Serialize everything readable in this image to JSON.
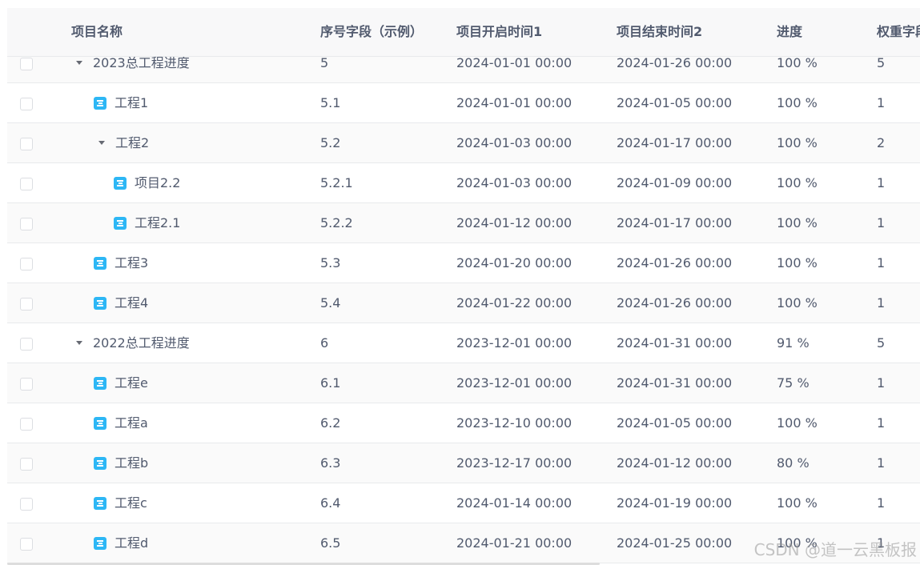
{
  "headers": {
    "name": "项目名称",
    "seq": "序号字段（示例）",
    "start": "项目开启时间1",
    "end": "项目结束时间2",
    "progress": "进度",
    "weight": "权重字段"
  },
  "rows": [
    {
      "name": "2023总工程进度",
      "level": 0,
      "type": "group",
      "seq": "5",
      "start": "2024-01-01 00:00",
      "end": "2024-01-26 00:00",
      "progress": "100 %",
      "weight": "5"
    },
    {
      "name": "工程1",
      "level": 1,
      "type": "leaf",
      "seq": "5.1",
      "start": "2024-01-01 00:00",
      "end": "2024-01-05 00:00",
      "progress": "100 %",
      "weight": "1"
    },
    {
      "name": "工程2",
      "level": 1,
      "type": "group",
      "seq": "5.2",
      "start": "2024-01-03 00:00",
      "end": "2024-01-17 00:00",
      "progress": "100 %",
      "weight": "2"
    },
    {
      "name": "项目2.2",
      "level": 2,
      "type": "leaf",
      "seq": "5.2.1",
      "start": "2024-01-03 00:00",
      "end": "2024-01-09 00:00",
      "progress": "100 %",
      "weight": "1"
    },
    {
      "name": "工程2.1",
      "level": 2,
      "type": "leaf",
      "seq": "5.2.2",
      "start": "2024-01-12 00:00",
      "end": "2024-01-17 00:00",
      "progress": "100 %",
      "weight": "1"
    },
    {
      "name": "工程3",
      "level": 1,
      "type": "leaf",
      "seq": "5.3",
      "start": "2024-01-20 00:00",
      "end": "2024-01-26 00:00",
      "progress": "100 %",
      "weight": "1"
    },
    {
      "name": "工程4",
      "level": 1,
      "type": "leaf",
      "seq": "5.4",
      "start": "2024-01-22 00:00",
      "end": "2024-01-26 00:00",
      "progress": "100 %",
      "weight": "1"
    },
    {
      "name": "2022总工程进度",
      "level": 0,
      "type": "group",
      "seq": "6",
      "start": "2023-12-01 00:00",
      "end": "2024-01-31 00:00",
      "progress": "91 %",
      "weight": "5"
    },
    {
      "name": "工程e",
      "level": 1,
      "type": "leaf",
      "seq": "6.1",
      "start": "2023-12-01 00:00",
      "end": "2024-01-31 00:00",
      "progress": "75 %",
      "weight": "1"
    },
    {
      "name": "工程a",
      "level": 1,
      "type": "leaf",
      "seq": "6.2",
      "start": "2023-12-10 00:00",
      "end": "2024-01-05 00:00",
      "progress": "100 %",
      "weight": "1"
    },
    {
      "name": "工程b",
      "level": 1,
      "type": "leaf",
      "seq": "6.3",
      "start": "2023-12-17 00:00",
      "end": "2024-01-12 00:00",
      "progress": "80 %",
      "weight": "1"
    },
    {
      "name": "工程c",
      "level": 1,
      "type": "leaf",
      "seq": "6.4",
      "start": "2024-01-14 00:00",
      "end": "2024-01-19 00:00",
      "progress": "100 %",
      "weight": "1"
    },
    {
      "name": "工程d",
      "level": 1,
      "type": "leaf",
      "seq": "6.5",
      "start": "2024-01-21 00:00",
      "end": "2024-01-25 00:00",
      "progress": "100 %",
      "weight": "1"
    }
  ],
  "watermark": "CSDN @道一云黑板报"
}
